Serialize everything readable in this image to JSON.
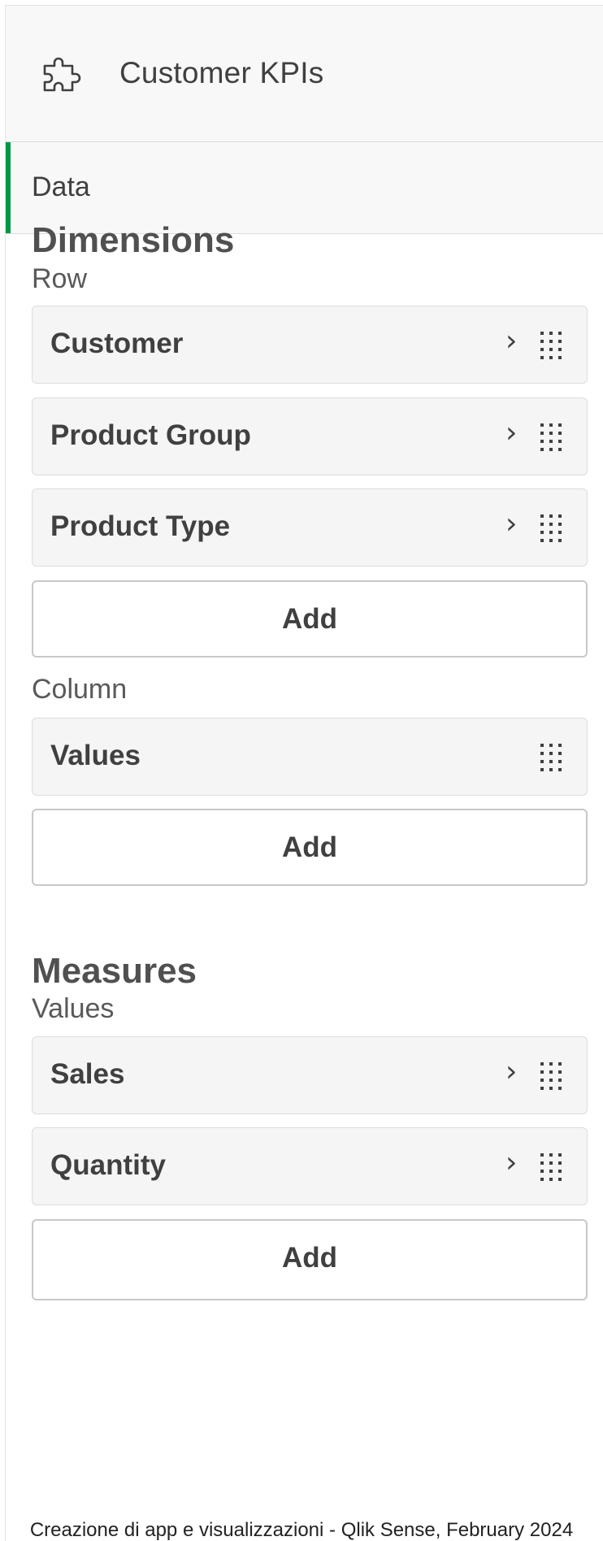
{
  "header": {
    "title": "Customer KPIs",
    "icon": "puzzle-icon"
  },
  "tabs": [
    {
      "label": "Data",
      "active": true,
      "accent_color": "#009845"
    }
  ],
  "dimensions": {
    "title": "Dimensions",
    "row": {
      "label": "Row",
      "items": [
        {
          "label": "Customer"
        },
        {
          "label": "Product Group"
        },
        {
          "label": "Product Type"
        }
      ],
      "add_label": "Add"
    },
    "column": {
      "label": "Column",
      "items": [
        {
          "label": "Values"
        }
      ],
      "add_label": "Add"
    }
  },
  "measures": {
    "title": "Measures",
    "values": {
      "label": "Values",
      "items": [
        {
          "label": "Sales"
        },
        {
          "label": "Quantity"
        }
      ],
      "add_label": "Add"
    }
  },
  "footer": {
    "text": "Creazione di app e visualizzazioni - Qlik Sense, February 2024"
  }
}
